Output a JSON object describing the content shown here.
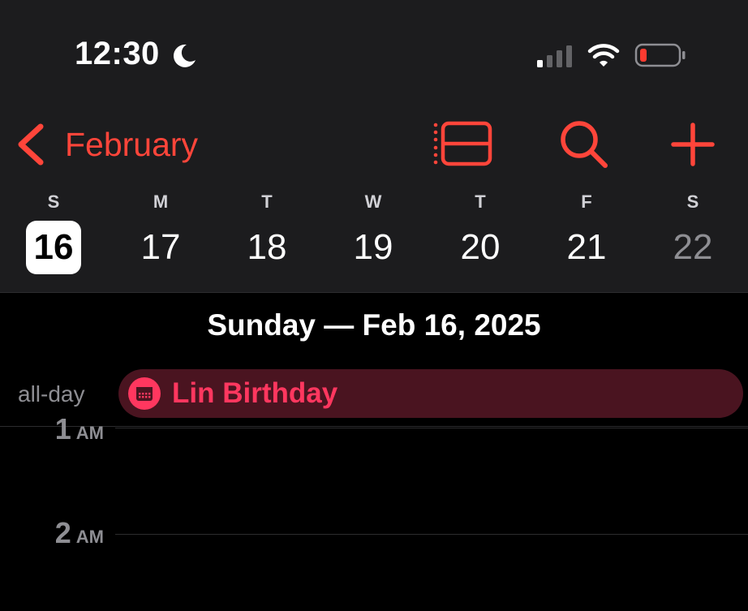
{
  "status_bar": {
    "time": "12:30",
    "focus_icon": "moon-icon",
    "signal_icon": "cellular-signal-icon",
    "wifi_icon": "wifi-icon",
    "battery_icon": "battery-low-icon",
    "battery_color": "#ff3b30"
  },
  "nav": {
    "back_icon": "chevron-left-icon",
    "month": "February",
    "list_icon": "list-view-icon",
    "search_icon": "search-icon",
    "add_icon": "plus-icon",
    "accent_color": "#ff453a"
  },
  "week": {
    "days": [
      {
        "dow": "S",
        "num": "16",
        "selected": true,
        "weekend": true
      },
      {
        "dow": "M",
        "num": "17",
        "selected": false,
        "weekend": false
      },
      {
        "dow": "T",
        "num": "18",
        "selected": false,
        "weekend": false
      },
      {
        "dow": "W",
        "num": "19",
        "selected": false,
        "weekend": false
      },
      {
        "dow": "T",
        "num": "20",
        "selected": false,
        "weekend": false
      },
      {
        "dow": "F",
        "num": "21",
        "selected": false,
        "weekend": false
      },
      {
        "dow": "S",
        "num": "22",
        "selected": false,
        "weekend": true
      }
    ]
  },
  "day_view": {
    "heading": "Sunday — Feb 16, 2025",
    "allday_label": "all-day",
    "allday_events": [
      {
        "title": "Lin Birthday",
        "icon": "birthday-calendar-icon",
        "color": "#ff375f"
      }
    ],
    "hours": [
      {
        "num": "1",
        "ampm": "AM"
      },
      {
        "num": "2",
        "ampm": "AM"
      }
    ]
  }
}
